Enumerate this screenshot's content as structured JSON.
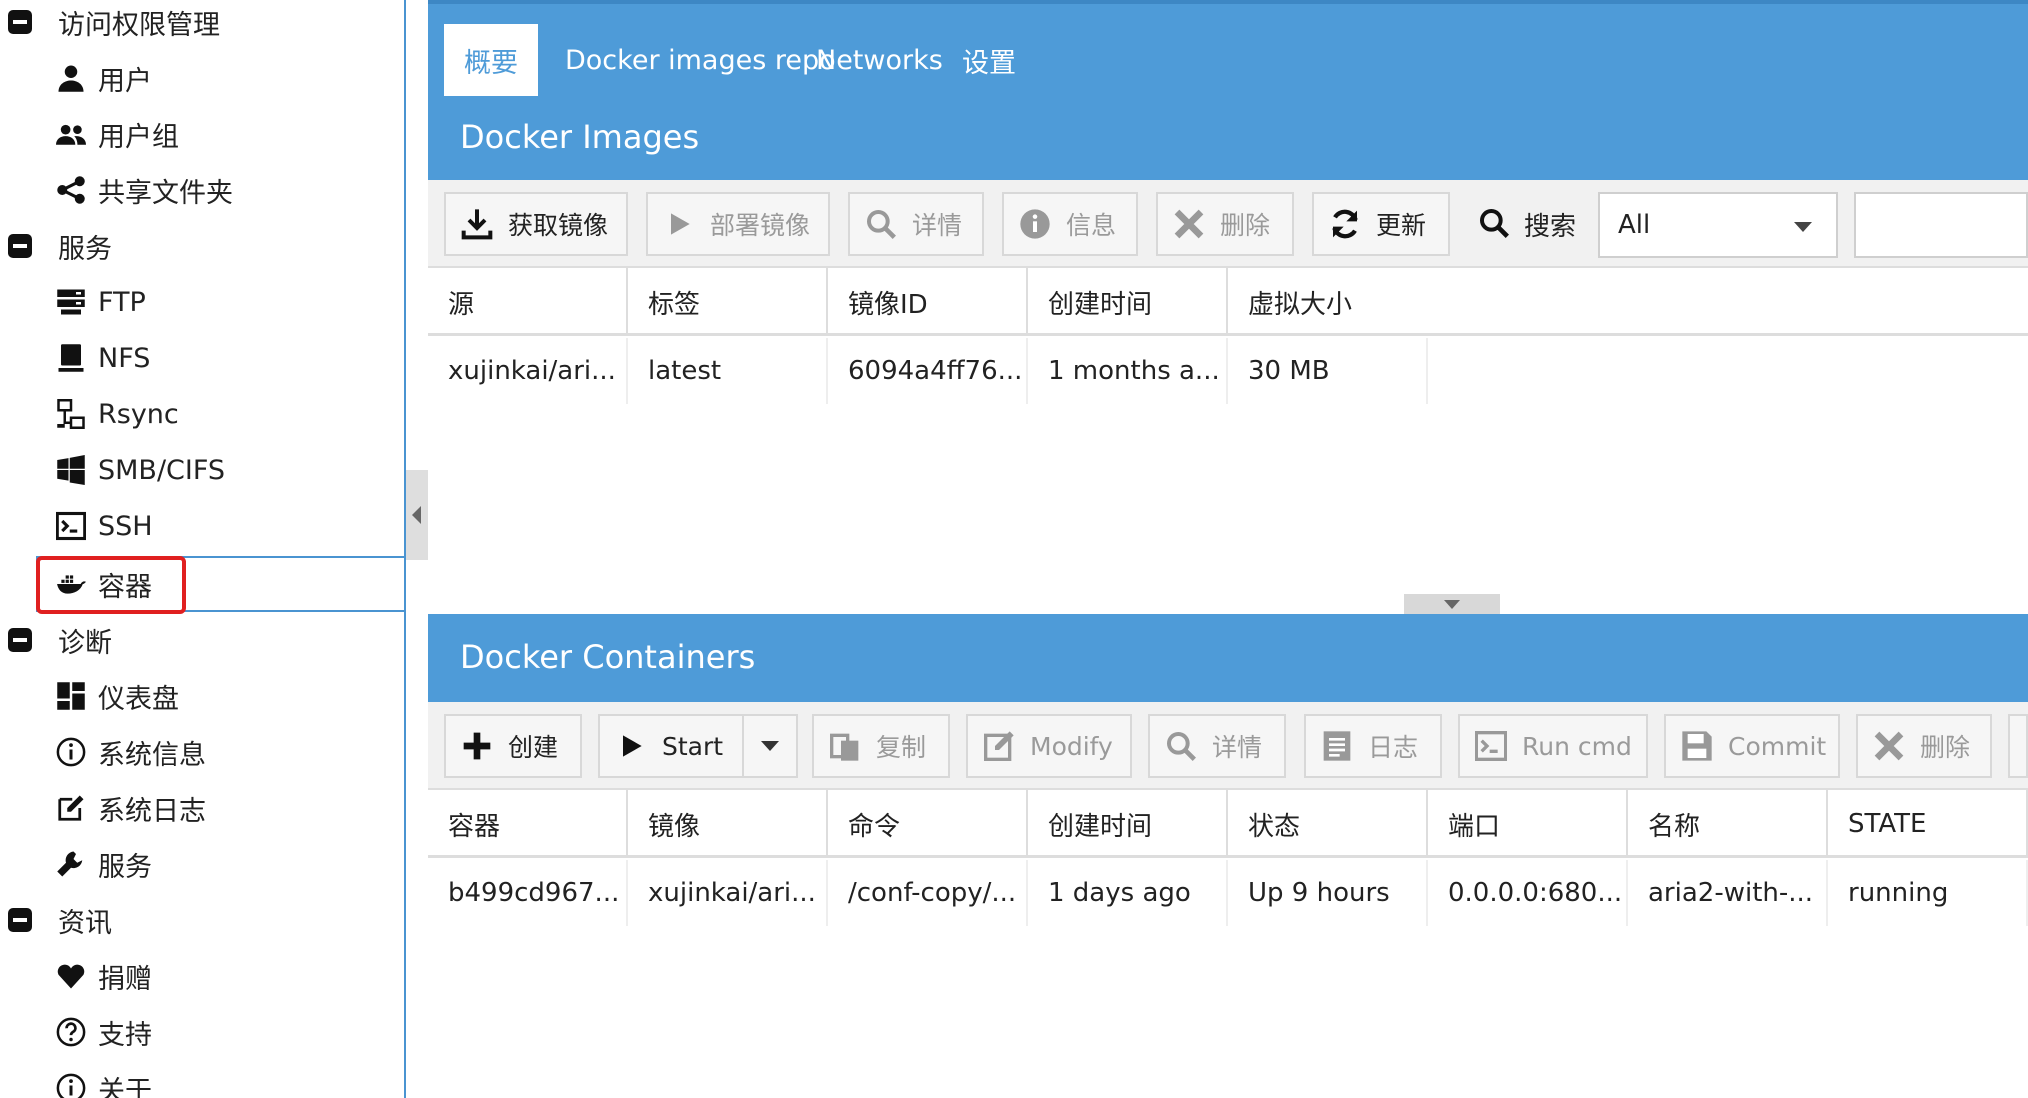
{
  "sidebar": {
    "groups": [
      {
        "label": "访问权限管理",
        "items": [
          {
            "label": "用户",
            "icon": "user-icon"
          },
          {
            "label": "用户组",
            "icon": "users-icon"
          },
          {
            "label": "共享文件夹",
            "icon": "share-icon"
          }
        ]
      },
      {
        "label": "服务",
        "items": [
          {
            "label": "FTP",
            "icon": "server-icon"
          },
          {
            "label": "NFS",
            "icon": "desktop-icon"
          },
          {
            "label": "Rsync",
            "icon": "network-icon"
          },
          {
            "label": "SMB/CIFS",
            "icon": "windows-icon"
          },
          {
            "label": "SSH",
            "icon": "terminal-icon"
          },
          {
            "label": "容器",
            "icon": "docker-icon"
          }
        ]
      },
      {
        "label": "诊断",
        "items": [
          {
            "label": "仪表盘",
            "icon": "dashboard-icon"
          },
          {
            "label": "系统信息",
            "icon": "info-icon"
          },
          {
            "label": "系统日志",
            "icon": "edit-icon"
          },
          {
            "label": "服务",
            "icon": "wrench-icon"
          }
        ]
      },
      {
        "label": "资讯",
        "items": [
          {
            "label": "捐赠",
            "icon": "heart-icon"
          },
          {
            "label": "支持",
            "icon": "question-icon"
          },
          {
            "label": "关于",
            "icon": "info-icon"
          }
        ]
      }
    ]
  },
  "tabs": [
    "概要",
    "Docker images repo",
    "Networks",
    "设置"
  ],
  "images_panel": {
    "title": "Docker Images",
    "toolbar": {
      "pull": "获取镜像",
      "deploy": "部署镜像",
      "details": "详情",
      "info": "信息",
      "delete": "删除",
      "refresh": "更新",
      "search_label": "搜索",
      "search_select": "All"
    },
    "columns": [
      "源",
      "标签",
      "镜像ID",
      "创建时间",
      "虚拟大小"
    ],
    "rows": [
      [
        "xujinkai/ari...",
        "latest",
        "6094a4ff76...",
        "1 months a...",
        "30 MB"
      ]
    ]
  },
  "containers_panel": {
    "title": "Docker Containers",
    "toolbar": {
      "create": "创建",
      "start": "Start",
      "copy": "复制",
      "modify": "Modify",
      "details": "详情",
      "logs": "日志",
      "run_cmd": "Run cmd",
      "commit": "Commit",
      "delete": "删除"
    },
    "columns": [
      "容器",
      "镜像",
      "命令",
      "创建时间",
      "状态",
      "端口",
      "名称",
      "STATE"
    ],
    "rows": [
      [
        "b499cd967...",
        "xujinkai/ari...",
        "/conf-copy/...",
        "1 days ago",
        "Up 9 hours",
        "0.0.0.0:680...",
        "aria2-with-...",
        "running"
      ]
    ]
  },
  "colors": {
    "accent": "#4e9bd8",
    "highlight": "#e02020"
  }
}
